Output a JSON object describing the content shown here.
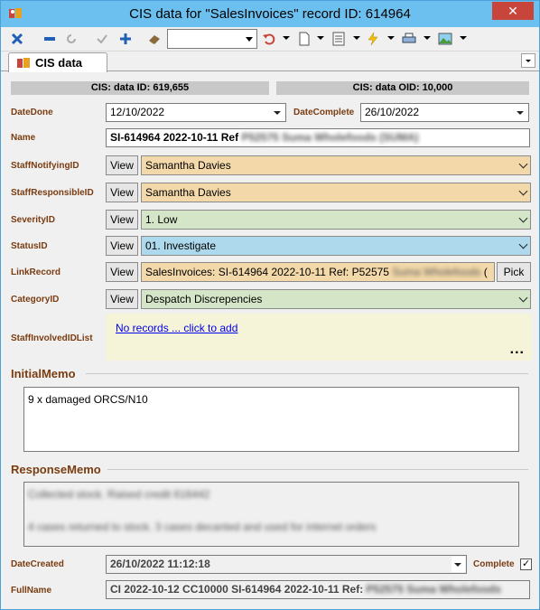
{
  "window": {
    "title": "CIS data for \"SalesInvoices\" record ID: 614964",
    "close_label": "✕"
  },
  "toolbar": {
    "icons": [
      "delete-icon",
      "minus-icon",
      "refresh-icon",
      "check-icon",
      "add-icon",
      "eraser-icon",
      "undo-icon",
      "new-document-icon",
      "form-icon",
      "lightning-icon",
      "print-icon",
      "picture-icon"
    ],
    "colors": {
      "blue": "#1f5fb8",
      "red": "#c7453a",
      "yellow": "#f2c200"
    }
  },
  "tabs": [
    {
      "label": "CIS data"
    }
  ],
  "header": {
    "id_label": "CIS: data ID: 619,655",
    "oid_label": "CIS: data OID: 10,000"
  },
  "fields": {
    "date_done": {
      "label": "DateDone",
      "value": "12/10/2022"
    },
    "date_complete": {
      "label": "DateComplete",
      "value": "26/10/2022"
    },
    "name": {
      "label": "Name",
      "value": "SI-614964 2022-10-11 Ref",
      "blurred": "P52575 Suma Wholefoods (SUMA)"
    },
    "staff_notifying": {
      "label": "StaffNotifyingID",
      "view": "View",
      "value": "Samantha Davies"
    },
    "staff_responsible": {
      "label": "StaffResponsibleID",
      "view": "View",
      "value": "Samantha Davies"
    },
    "severity": {
      "label": "SeverityID",
      "view": "View",
      "value": "1. Low"
    },
    "status": {
      "label": "StatusID",
      "view": "View",
      "value": "01. Investigate"
    },
    "link_record": {
      "label": "LinkRecord",
      "view": "View",
      "value": "SalesInvoices: SI-614964 2022-10-11 Ref: P52575",
      "blurred": "Suma Wholefoods",
      "suffix": "(",
      "pick": "Pick"
    },
    "category": {
      "label": "CategoryID",
      "view": "View",
      "value": "Despatch Discrepencies"
    },
    "staff_involved": {
      "label": "StaffInvolvedIDList",
      "link": "No records ... click to add",
      "more": "..."
    }
  },
  "initial_memo": {
    "label": "InitialMemo",
    "text": "9 x damaged ORCS/N10"
  },
  "response_memo": {
    "label": "ResponseMemo",
    "lines": [
      "Collected stock. Raised credit 616442",
      "4 cases returned to stock. 3 cases decanted and used for internet orders"
    ]
  },
  "footer": {
    "date_created": {
      "label": "DateCreated",
      "value": "26/10/2022 11:12:18"
    },
    "complete": {
      "label": "Complete",
      "checked": true
    },
    "full_name": {
      "label": "FullName",
      "value": "CI 2022-10-12 CC10000 SI-614964 2022-10-11 Ref:",
      "blurred": "P52575 Suma Wholefoods"
    }
  }
}
